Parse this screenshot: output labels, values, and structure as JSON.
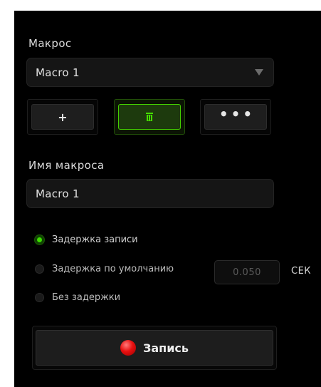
{
  "macro_section": {
    "label": "Макрос"
  },
  "macro_select": {
    "value": "Macro 1"
  },
  "buttons": {
    "add": "+",
    "delete_icon": "trash-icon",
    "more": "•••"
  },
  "name_section": {
    "label": "Имя макроса",
    "value": "Macro 1"
  },
  "delay_options": [
    {
      "label": "Задержка записи",
      "selected": true
    },
    {
      "label": "Задержка по умолчанию",
      "selected": false
    },
    {
      "label": "Без задержки",
      "selected": false
    }
  ],
  "default_delay": {
    "value": "0.050",
    "unit": "СЕК"
  },
  "record_button": {
    "label": "Запись"
  },
  "colors": {
    "accent": "#44d000",
    "record": "#e81010",
    "background": "#000000"
  }
}
